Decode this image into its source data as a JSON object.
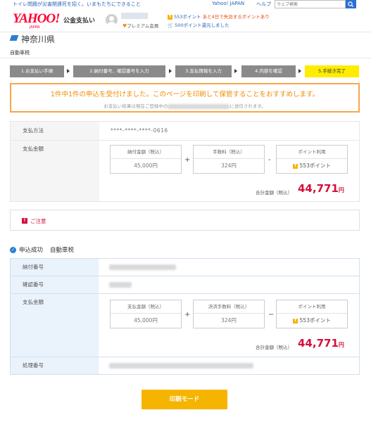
{
  "topbar": {
    "news_link": "トイレ問題が災害関連死を招く。いまもたちにできること",
    "yahoo_japan_link": "Yahoo! JAPAN",
    "help_link": "ヘルプ",
    "search_placeholder": "ウェブ検索"
  },
  "header": {
    "logo_text": "YAHOO!",
    "logo_sub": "JAPAN",
    "service_title": "公金支払い",
    "premium_label": "プレミアム会員",
    "points_available": "553ポイント",
    "points_expiring": "あと4日で失効するポイントあり",
    "points_return": "500ポイント還元しました"
  },
  "page": {
    "prefecture": "神奈川県",
    "tax_type": "自動車税"
  },
  "steps": [
    {
      "label": "1.お支払い手順"
    },
    {
      "label": "2.納付番号、確認番号を入力"
    },
    {
      "label": "3.支払情報を入力"
    },
    {
      "label": "4.内容を確認"
    },
    {
      "label": "5.手続き完了"
    }
  ],
  "notice": {
    "main": "1件中1件の申込を受付けました。このページを印刷して保管することをおすすめします。",
    "sub_before": "お支払い結果は現在ご登録中の",
    "sub_after": "に送信されます。"
  },
  "payment_summary": {
    "method_label": "支払方法",
    "method_value": "****-****-****-0616",
    "amount_label": "支払金額",
    "boxes": [
      {
        "header": "納付金額（税込）",
        "value": "45,000円"
      },
      {
        "header": "手数料（税込）",
        "value": "324円"
      },
      {
        "header": "ポイント利用",
        "value": "553ポイント"
      }
    ],
    "op_plus": "+",
    "op_minus": "-",
    "total_label": "合計金額（税込）",
    "total_value": "44,771",
    "total_unit": "円"
  },
  "caution": {
    "icon": "!",
    "label": "ご注意"
  },
  "result": {
    "status": "申込成功",
    "tax_type": "自動車税",
    "rows": {
      "payment_number_label": "納付番号",
      "confirm_number_label": "確認番号",
      "amount_label": "支払金額",
      "process_number_label": "処理番号"
    },
    "boxes": [
      {
        "header": "支払金額（税込）",
        "value": "45,000円"
      },
      {
        "header": "決済手数料（税込）",
        "value": "324円"
      },
      {
        "header": "ポイント利用",
        "value": "553ポイント"
      }
    ],
    "op_plus": "+",
    "op_minus": "−",
    "total_label": "合計金額（税込）",
    "total_value": "44,771",
    "total_unit": "円"
  },
  "print_button": "印刷モード",
  "colors": {
    "brand_red": "#ff0033",
    "accent_orange": "#f08c00",
    "step_active": "#ffec00",
    "total_red": "#d3103a",
    "print_button": "#f5b400"
  }
}
